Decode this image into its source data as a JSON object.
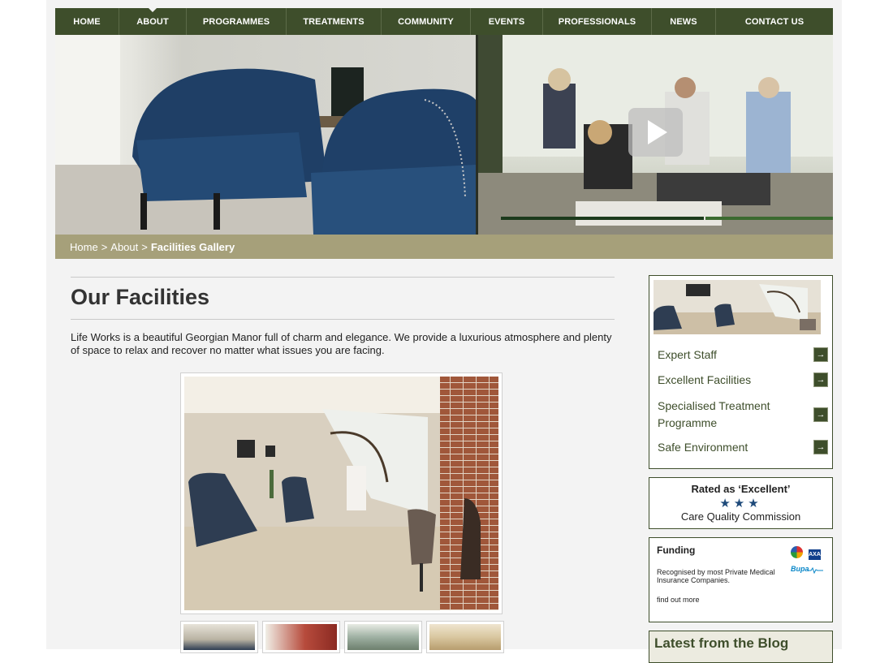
{
  "nav": {
    "items": [
      {
        "label": "HOME"
      },
      {
        "label": "ABOUT"
      },
      {
        "label": "PROGRAMMES"
      },
      {
        "label": "TREATMENTS"
      },
      {
        "label": "COMMUNITY"
      },
      {
        "label": "EVENTS"
      },
      {
        "label": "PROFESSIONALS"
      },
      {
        "label": "NEWS"
      },
      {
        "label": "CONTACT US"
      }
    ],
    "active": "ABOUT"
  },
  "breadcrumb": {
    "home": "Home",
    "about": "About",
    "separator": ">",
    "current": "Facilities Gallery"
  },
  "main": {
    "title": "Our Facilities",
    "intro": "Life Works is a beautiful Georgian Manor full of charm and elegance. We provide a luxurious atmosphere and plenty of space to relax and recover no matter what issues you are facing."
  },
  "sidebar": {
    "features": [
      {
        "label": "Expert Staff"
      },
      {
        "label": "Excellent Facilities"
      },
      {
        "label": "Specialised Treatment Programme"
      },
      {
        "label": "Safe Environment"
      }
    ],
    "arrow_glyph": "→",
    "cqc": {
      "title": "Rated as ‘Excellent’",
      "stars": "★★★",
      "name": "Care Quality Commission"
    },
    "funding": {
      "title": "Funding",
      "text": "Recognised by most Private Medical Insurance Companies.",
      "more": "find out more",
      "axa": "AXA",
      "bupa": "Bupa"
    },
    "blog": {
      "title": "Latest from the Blog"
    }
  },
  "colors": {
    "nav_bg": "#3e4e2b",
    "breadcrumb_bg": "#a6a07a",
    "page_bg": "#f3f3f3",
    "link_green": "#3e4e2b",
    "star_blue": "#1e4a7a"
  }
}
